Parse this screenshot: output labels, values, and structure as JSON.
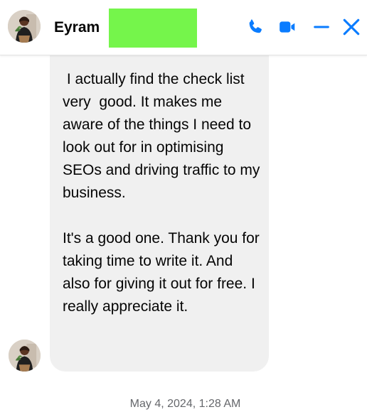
{
  "header": {
    "contact_name": "Eyram",
    "icons": [
      "phone-icon",
      "video-camera-icon",
      "minimize-icon",
      "close-icon"
    ],
    "accent_color": "#0a7cff",
    "redaction_color": "#75f54b"
  },
  "conversation": {
    "message": {
      "paragraphs": [
        " I actually find the check list very  good. It makes me aware of the things I need to look out for in optimising SEOs and driving traffic to my business.",
        "It's a good one. Thank you for taking time to write it. And also for giving it out for free. I really appreciate it."
      ],
      "bubble_color": "#f0f0f0"
    },
    "timestamp": "May 4, 2024, 1:28 AM"
  }
}
